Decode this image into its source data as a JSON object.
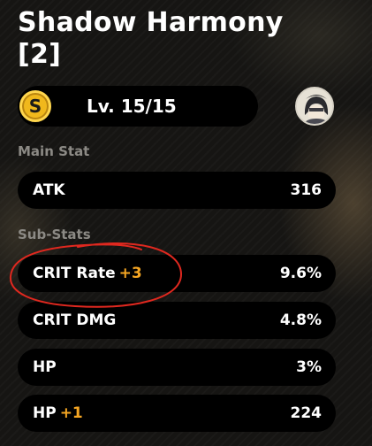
{
  "disc": {
    "title": "Shadow Harmony",
    "slot": "[2]",
    "level_text": "Lv. 15/15",
    "rank_badge": "S",
    "avatar_icon": "character-portrait-icon"
  },
  "main_stat_section": {
    "label": "Main Stat",
    "stat": {
      "name": "ATK",
      "value": "316"
    }
  },
  "sub_stats_section": {
    "label": "Sub-Stats",
    "items": [
      {
        "name": "CRIT Rate",
        "boost": "+3",
        "value": "9.6%"
      },
      {
        "name": "CRIT DMG",
        "boost": "",
        "value": "4.8%"
      },
      {
        "name": "HP",
        "boost": "",
        "value": "3%"
      },
      {
        "name": "HP",
        "boost": "+1",
        "value": "224"
      }
    ]
  },
  "colors": {
    "boost": "#f5a623",
    "badge": "#f0b81c",
    "annotation": "#e0281f",
    "section_label": "#8c8a85"
  }
}
